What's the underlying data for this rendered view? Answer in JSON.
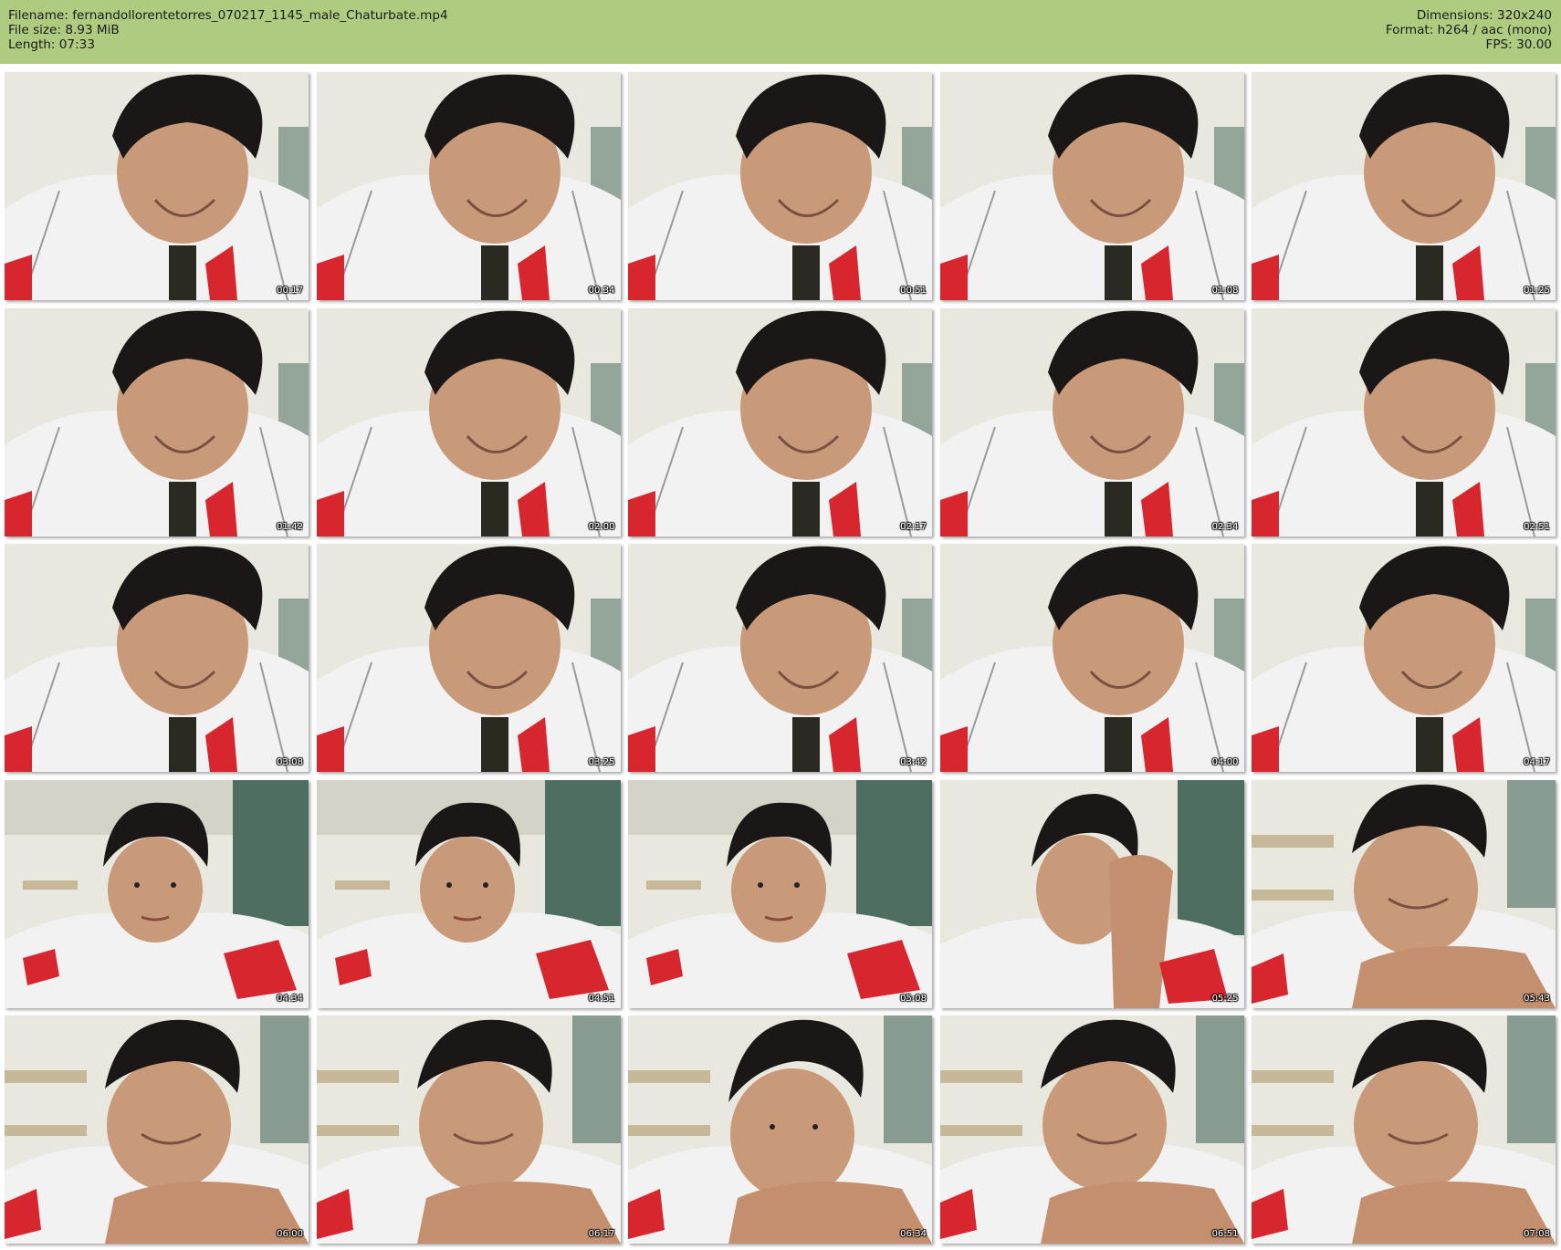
{
  "header": {
    "filename": "Filename: fernandollorentetorres_070217_1145_male_Chaturbate.mp4",
    "file_size": "File size: 8.93 MiB",
    "length": "Length: 07:33",
    "dimensions": "Dimensions: 320x240",
    "format": "Format: h264 / aac (mono)",
    "fps": "FPS: 30.00"
  },
  "colors": {
    "header_bg": "#aecb80",
    "wall": "#e9e8df",
    "jacket": "#f2f2f2",
    "hair": "#1b1717",
    "skin": "#c99a7a",
    "red_logo": "#d8262e"
  },
  "thumbnails": [
    {
      "time": "00:17",
      "scene": "looking-down"
    },
    {
      "time": "00:34",
      "scene": "looking-down"
    },
    {
      "time": "00:51",
      "scene": "looking-down"
    },
    {
      "time": "01:08",
      "scene": "looking-down"
    },
    {
      "time": "01:25",
      "scene": "looking-down"
    },
    {
      "time": "01:42",
      "scene": "looking-down"
    },
    {
      "time": "02:00",
      "scene": "looking-down"
    },
    {
      "time": "02:17",
      "scene": "looking-down"
    },
    {
      "time": "02:34",
      "scene": "looking-down"
    },
    {
      "time": "02:51",
      "scene": "looking-down"
    },
    {
      "time": "03:08",
      "scene": "looking-down"
    },
    {
      "time": "03:25",
      "scene": "looking-down"
    },
    {
      "time": "03:42",
      "scene": "looking-down"
    },
    {
      "time": "04:00",
      "scene": "looking-down"
    },
    {
      "time": "04:17",
      "scene": "looking-down"
    },
    {
      "time": "04:34",
      "scene": "facing-camera"
    },
    {
      "time": "04:51",
      "scene": "facing-camera"
    },
    {
      "time": "05:08",
      "scene": "facing-camera"
    },
    {
      "time": "05:25",
      "scene": "hand-on-face"
    },
    {
      "time": "05:43",
      "scene": "resting-chin"
    },
    {
      "time": "06:00",
      "scene": "resting-chin"
    },
    {
      "time": "06:17",
      "scene": "resting-chin"
    },
    {
      "time": "06:34",
      "scene": "resting-chin-up"
    },
    {
      "time": "06:51",
      "scene": "resting-chin"
    },
    {
      "time": "07:08",
      "scene": "resting-chin"
    }
  ]
}
